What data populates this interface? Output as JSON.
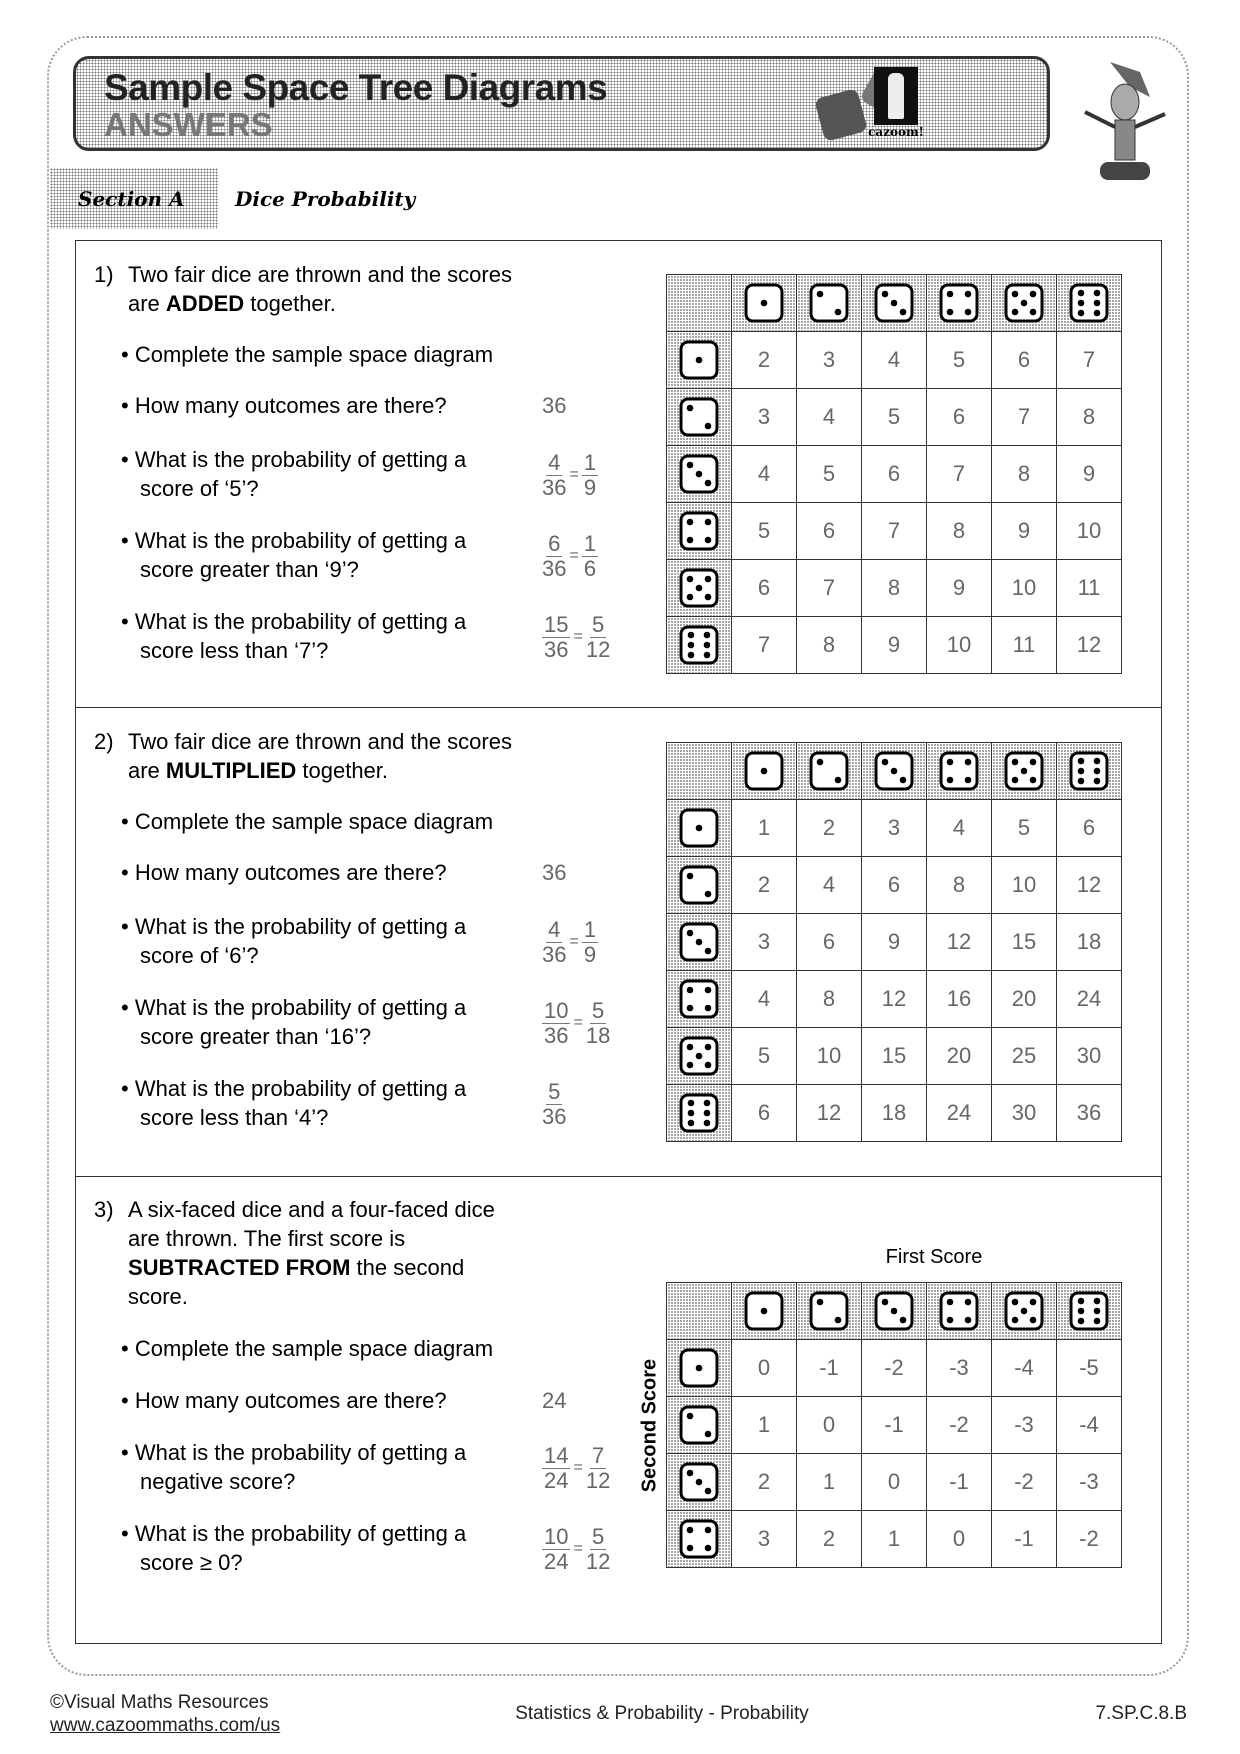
{
  "header": {
    "title": "Sample Space Tree Diagrams",
    "subtitle": "ANSWERS",
    "logo_text": "cazoom!"
  },
  "section": {
    "label": "Section A",
    "title": "Dice Probability"
  },
  "questions": [
    {
      "number": "1)",
      "text_parts": [
        {
          "t": "Two fair dice are thrown and the scores are ",
          "b": false
        },
        {
          "t": "ADDED",
          "b": true
        },
        {
          "t": " together.",
          "b": false
        }
      ],
      "bullets": [
        {
          "text": "• Complete the sample space diagram",
          "answer": null
        },
        {
          "text": "• How many outcomes are there?",
          "answer": {
            "value": "36"
          }
        },
        {
          "text": "• What is the probability of getting a score of ‘5’?",
          "answer": {
            "fractions": [
              [
                "4",
                "36"
              ],
              [
                "1",
                "9"
              ]
            ]
          }
        },
        {
          "text": "• What is the probability of getting a score greater than ‘9’?",
          "answer": {
            "fractions": [
              [
                "6",
                "36"
              ],
              [
                "1",
                "6"
              ]
            ]
          }
        },
        {
          "text": "• What is the probability of getting a score less than ‘7’?",
          "answer": {
            "fractions": [
              [
                "15",
                "36"
              ],
              [
                "5",
                "12"
              ]
            ]
          }
        }
      ],
      "table": {
        "column_dice": [
          1,
          2,
          3,
          4,
          5,
          6
        ],
        "row_dice": [
          1,
          2,
          3,
          4,
          5,
          6
        ],
        "cells": [
          [
            "2",
            "3",
            "4",
            "5",
            "6",
            "7"
          ],
          [
            "3",
            "4",
            "5",
            "6",
            "7",
            "8"
          ],
          [
            "4",
            "5",
            "6",
            "7",
            "8",
            "9"
          ],
          [
            "5",
            "6",
            "7",
            "8",
            "9",
            "10"
          ],
          [
            "6",
            "7",
            "8",
            "9",
            "10",
            "11"
          ],
          [
            "7",
            "8",
            "9",
            "10",
            "11",
            "12"
          ]
        ]
      }
    },
    {
      "number": "2)",
      "text_parts": [
        {
          "t": "Two fair dice are thrown and the scores are ",
          "b": false
        },
        {
          "t": "MULTIPLIED",
          "b": true
        },
        {
          "t": " together.",
          "b": false
        }
      ],
      "bullets": [
        {
          "text": "• Complete the sample space diagram",
          "answer": null
        },
        {
          "text": "• How many outcomes are there?",
          "answer": {
            "value": "36"
          }
        },
        {
          "text": "• What is the probability of getting a score of ‘6’?",
          "answer": {
            "fractions": [
              [
                "4",
                "36"
              ],
              [
                "1",
                "9"
              ]
            ]
          }
        },
        {
          "text": "• What is the probability of getting a score greater than ‘16’?",
          "answer": {
            "fractions": [
              [
                "10",
                "36"
              ],
              [
                "5",
                "18"
              ]
            ]
          }
        },
        {
          "text": "• What is the probability of getting a score less than ‘4’?",
          "answer": {
            "fractions": [
              [
                "5",
                "36"
              ]
            ]
          }
        }
      ],
      "table": {
        "column_dice": [
          1,
          2,
          3,
          4,
          5,
          6
        ],
        "row_dice": [
          1,
          2,
          3,
          4,
          5,
          6
        ],
        "cells": [
          [
            "1",
            "2",
            "3",
            "4",
            "5",
            "6"
          ],
          [
            "2",
            "4",
            "6",
            "8",
            "10",
            "12"
          ],
          [
            "3",
            "6",
            "9",
            "12",
            "15",
            "18"
          ],
          [
            "4",
            "8",
            "12",
            "16",
            "20",
            "24"
          ],
          [
            "5",
            "10",
            "15",
            "20",
            "25",
            "30"
          ],
          [
            "6",
            "12",
            "18",
            "24",
            "30",
            "36"
          ]
        ]
      }
    },
    {
      "number": "3)",
      "text_parts": [
        {
          "t": "A six-faced dice and a four-faced dice are thrown. The first score is ",
          "b": false
        },
        {
          "t": "SUBTRACTED FROM",
          "b": true
        },
        {
          "t": " the second score.",
          "b": false
        }
      ],
      "bullets": [
        {
          "text": "• Complete the sample space diagram",
          "answer": null
        },
        {
          "text": "• How many outcomes are there?",
          "answer": {
            "value": "24"
          }
        },
        {
          "text": "• What is the probability of getting a negative score?",
          "answer": {
            "fractions": [
              [
                "14",
                "24"
              ],
              [
                "7",
                "12"
              ]
            ]
          }
        },
        {
          "text": "• What is the probability of getting a score ≥ 0?",
          "answer": {
            "fractions": [
              [
                "10",
                "24"
              ],
              [
                "5",
                "12"
              ]
            ]
          }
        }
      ],
      "table": {
        "column_label": "First Score",
        "row_label": "Second Score",
        "column_dice": [
          1,
          2,
          3,
          4,
          5,
          6
        ],
        "row_dice": [
          1,
          2,
          3,
          4
        ],
        "cells": [
          [
            "0",
            "-1",
            "-2",
            "-3",
            "-4",
            "-5"
          ],
          [
            "1",
            "0",
            "-1",
            "-2",
            "-3",
            "-4"
          ],
          [
            "2",
            "1",
            "0",
            "-1",
            "-2",
            "-3"
          ],
          [
            "3",
            "2",
            "1",
            "0",
            "-1",
            "-2"
          ]
        ]
      }
    }
  ],
  "footer": {
    "copyright": "©Visual Maths Resources",
    "link": "www.cazoommaths.com/us",
    "topic": "Statistics & Probability - Probability",
    "code": "7.SP.C.8.B"
  }
}
